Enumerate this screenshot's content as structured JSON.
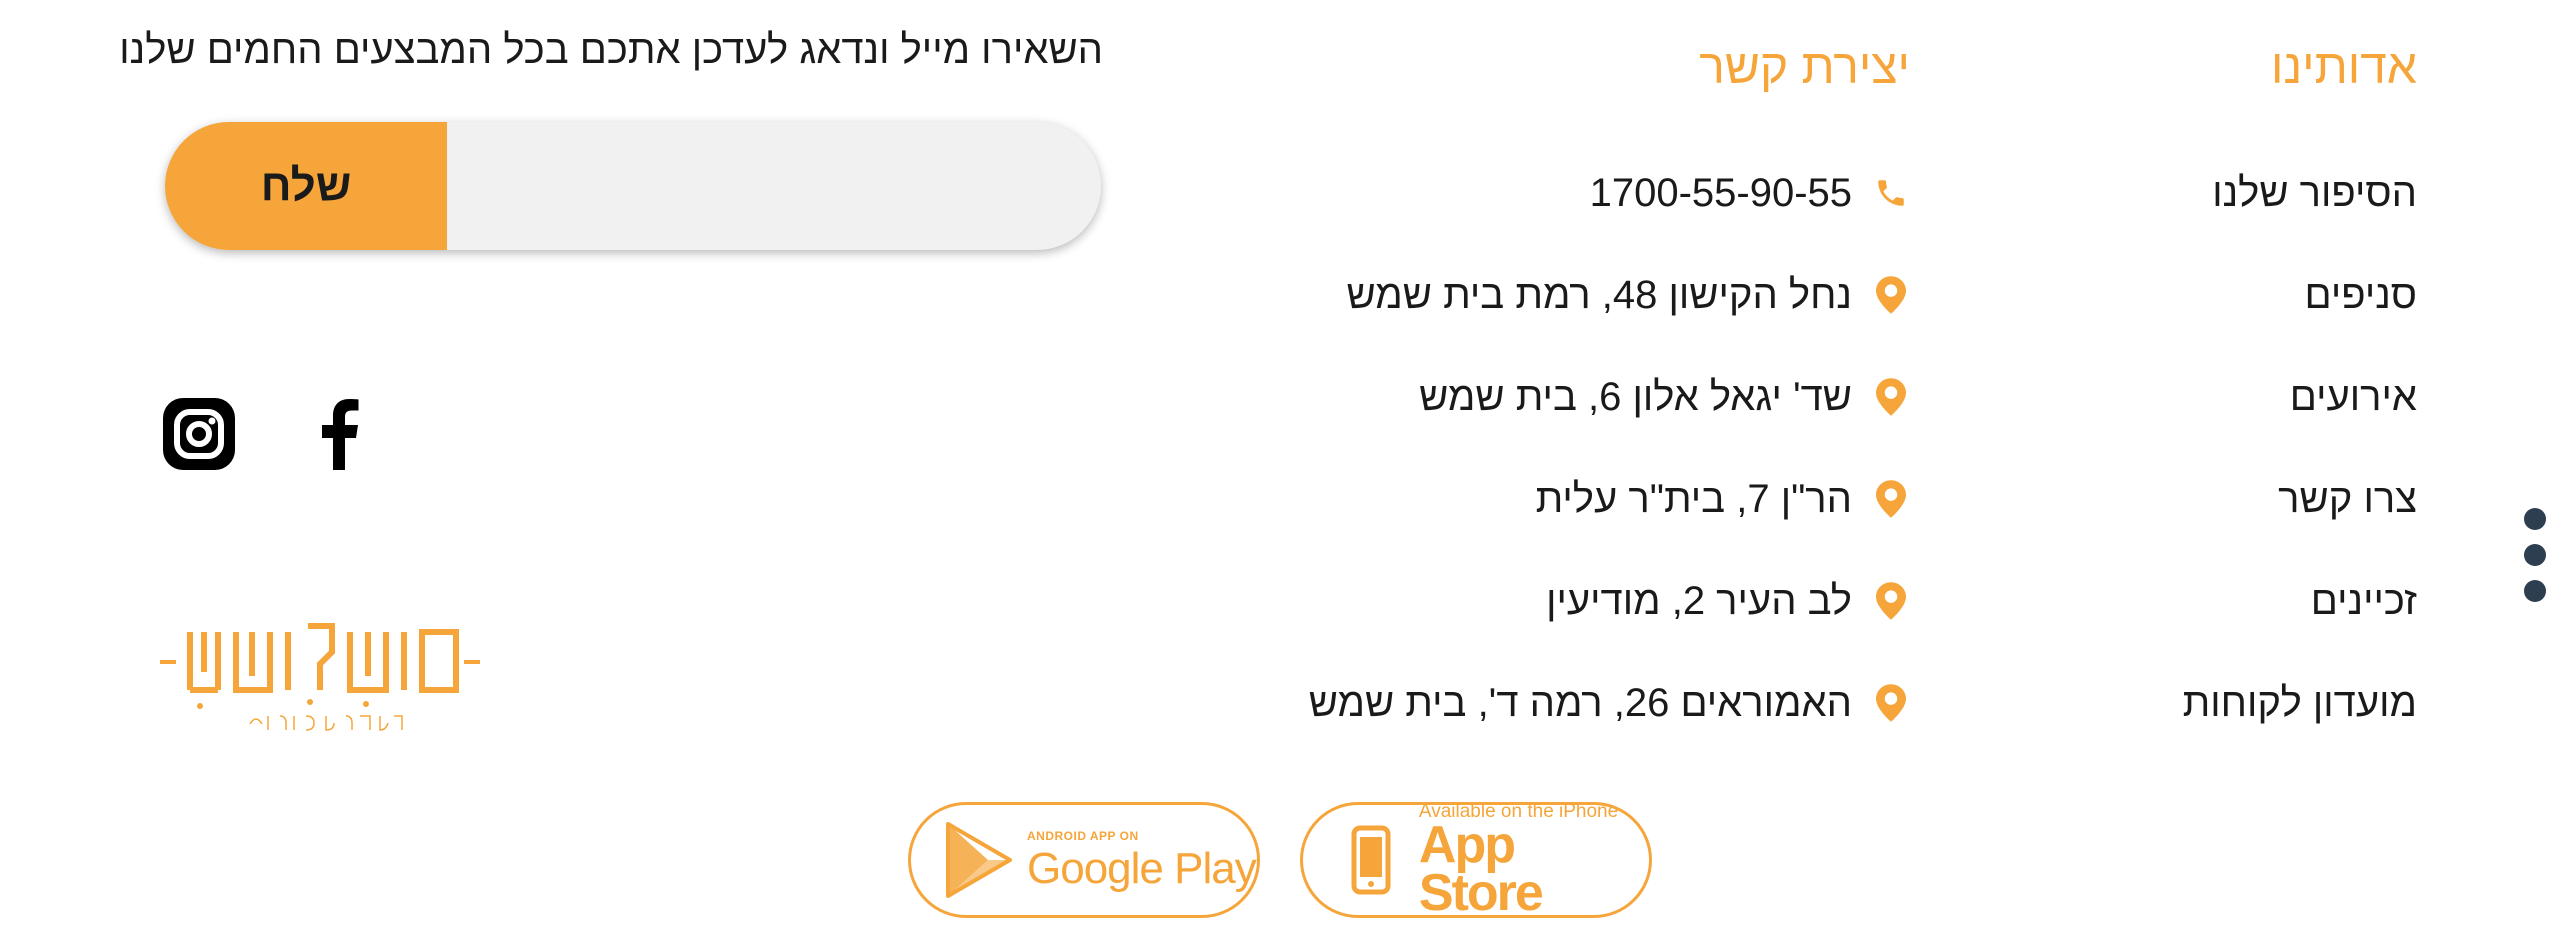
{
  "about": {
    "heading": "אדותינו",
    "items": [
      "הסיפור שלנו",
      "סניפים",
      "אירועים",
      "צרו קשר",
      "זכיינים",
      "מועדון לקוחות"
    ]
  },
  "contact": {
    "heading": "יצירת קשר",
    "items": [
      {
        "icon": "phone-icon",
        "text": "1700-55-90-55"
      },
      {
        "icon": "location-pin-icon",
        "text": "נחל הקישון 48, רמת בית שמש"
      },
      {
        "icon": "location-pin-icon",
        "text": "שד' יגאל אלון 6, בית שמש"
      },
      {
        "icon": "location-pin-icon",
        "text": "הר\"ן 7, בית\"ר עלית"
      },
      {
        "icon": "location-pin-icon",
        "text": "לב העיר 2, מודיעין"
      },
      {
        "icon": "location-pin-icon",
        "text": "האמוראים 26, רמה ד', בית שמש"
      }
    ]
  },
  "newsletter": {
    "title": "השאירו מייל ונדאג לעדכן אתכם בכל המבצעים החמים שלנו",
    "input_value": "",
    "send_label": "שלח"
  },
  "social": {
    "icons": [
      "facebook-icon",
      "instagram-icon"
    ]
  },
  "logo": {
    "name": "מְשׁוּלָשִׁים",
    "tagline": "חלבי משפחתי"
  },
  "apps": {
    "google": {
      "small": "ANDROID APP ON",
      "big": "Google Play"
    },
    "apple": {
      "small": "Available on the iPhone",
      "big": "App Store"
    }
  },
  "colors": {
    "accent": "#f5a53a",
    "text": "#1a1a1a",
    "dots": "#2d3e50"
  }
}
